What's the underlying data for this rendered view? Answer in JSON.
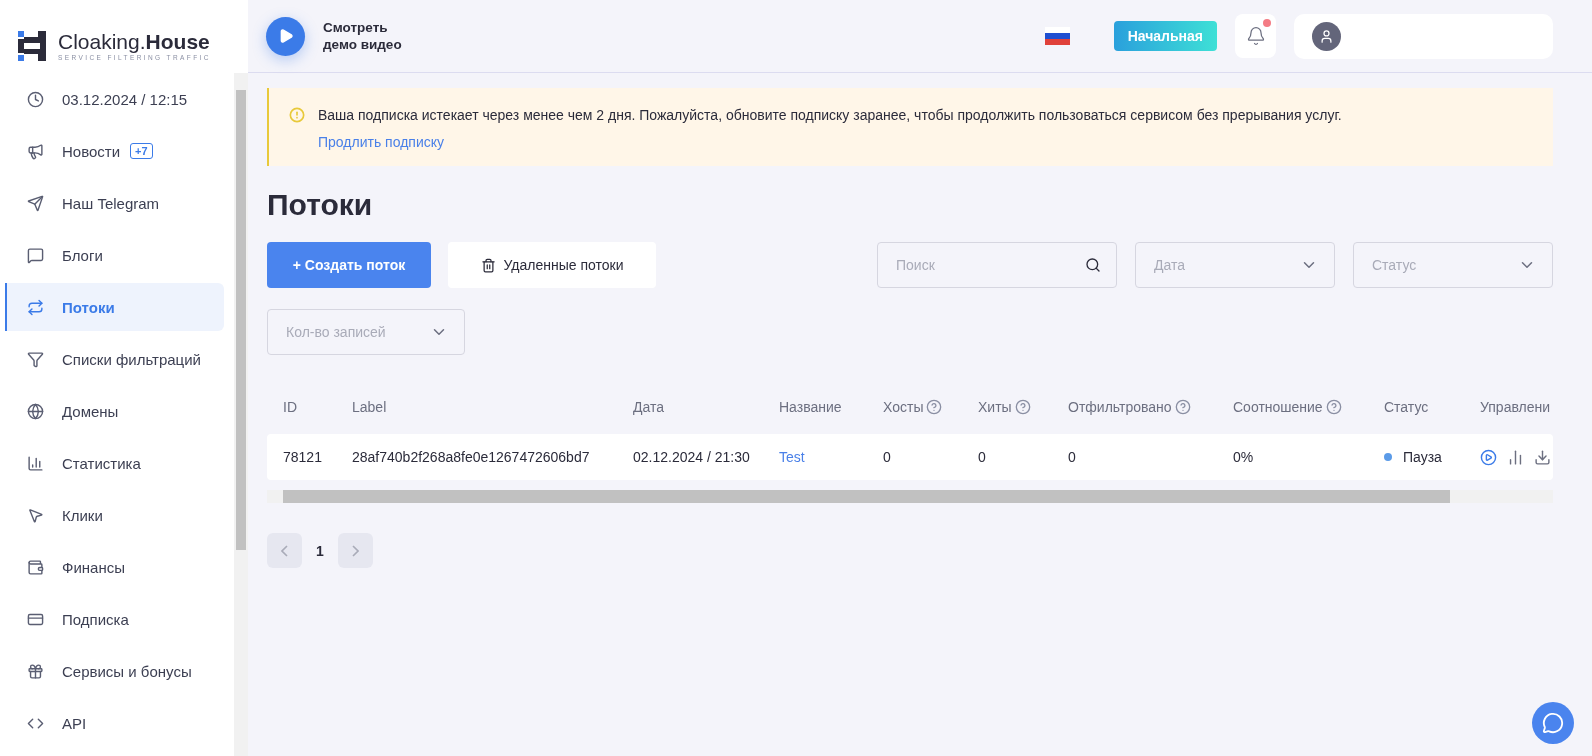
{
  "logo": {
    "name": "Cloaking.**House**",
    "tagline": "SERVICE FILTERING TRAFFIC"
  },
  "sidebar": {
    "items": [
      {
        "kind": "clock",
        "label": "03.12.2024 / 12:15",
        "selected": false
      },
      {
        "kind": "news",
        "label": "Новости",
        "badge": "+7",
        "selected": false
      },
      {
        "kind": "telegram",
        "label": "Наш Telegram",
        "selected": false
      },
      {
        "kind": "blogs",
        "label": "Блоги",
        "selected": false
      },
      {
        "kind": "flows",
        "label": "Потоки",
        "selected": true
      },
      {
        "kind": "filters",
        "label": "Списки фильтраций",
        "selected": false
      },
      {
        "kind": "domains",
        "label": "Домены",
        "selected": false
      },
      {
        "kind": "stats",
        "label": "Статистика",
        "selected": false
      },
      {
        "kind": "clicks",
        "label": "Клики",
        "selected": false
      },
      {
        "kind": "finance",
        "label": "Финансы",
        "selected": false
      },
      {
        "kind": "subscription",
        "label": "Подписка",
        "selected": false
      },
      {
        "kind": "services",
        "label": "Сервисы и бонусы",
        "selected": false
      },
      {
        "kind": "api",
        "label": "API",
        "selected": false
      }
    ]
  },
  "header": {
    "demo": [
      "Смотреть",
      "демо видео"
    ],
    "plan_button": "Начальная",
    "notifications_unread": true
  },
  "alert": {
    "message": "Ваша подписка истекает через менее чем 2 дня. Пожалуйста, обновите подписку заранее, чтобы продолжить пользоваться сервисом без прерывания услуг.",
    "link": "Продлить подписку"
  },
  "page_title": "Потоки",
  "actions": {
    "create": "+ Создать поток",
    "deleted": "Удаленные потоки"
  },
  "filters": {
    "search": {
      "placeholder": "Поиск"
    },
    "date": {
      "placeholder": "Дата"
    },
    "status": {
      "placeholder": "Статус"
    },
    "page_size": {
      "placeholder": "Кол-во записей"
    }
  },
  "table": {
    "columns": [
      {
        "label": "ID",
        "help": false
      },
      {
        "label": "Label",
        "help": false
      },
      {
        "label": "Дата",
        "help": false
      },
      {
        "label": "Название",
        "help": false
      },
      {
        "label": "Хосты",
        "help": true
      },
      {
        "label": "Хиты",
        "help": true
      },
      {
        "label": "Отфильтровано",
        "help": true
      },
      {
        "label": "Соотношение",
        "help": true
      },
      {
        "label": "Статус",
        "help": false
      },
      {
        "label": "Управлени"
      }
    ],
    "rows": [
      {
        "id": "78121",
        "label": "28af740b2f268a8fe0e1267472606bd7",
        "date": "02.12.2024 / 21:30",
        "name": "Test",
        "hosts": "0",
        "hits": "0",
        "filtered": "0",
        "ratio": "0%",
        "status": {
          "label": "Пауза",
          "color": "#5b9be8"
        }
      }
    ]
  },
  "pagination": {
    "pages": [
      {
        "label": "1",
        "selected": true
      }
    ]
  }
}
